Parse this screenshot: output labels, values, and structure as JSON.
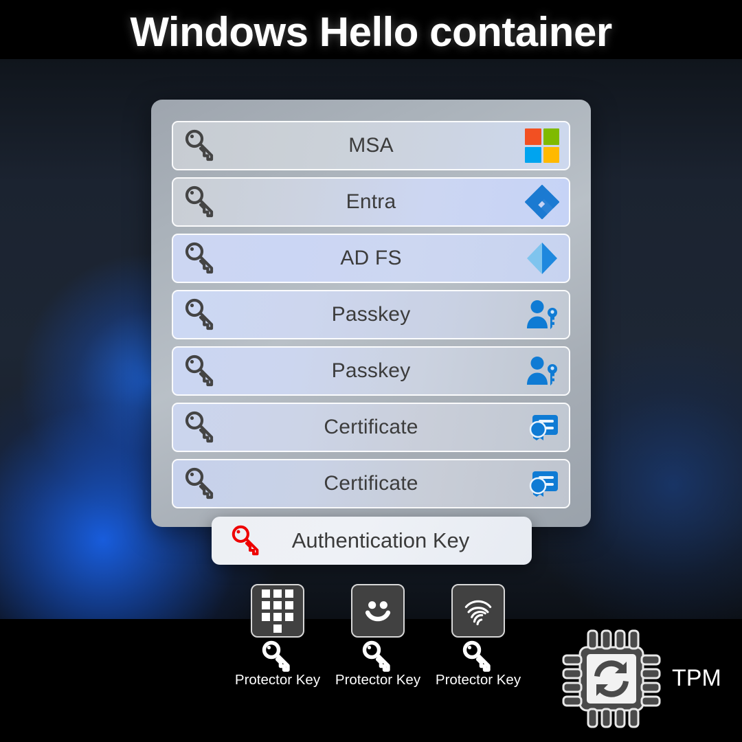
{
  "page": {
    "title": "Windows Hello container",
    "background_color": "#1d2634",
    "bar_color": "#000000"
  },
  "container": {
    "name": "Windows Hello container panel",
    "rows": [
      {
        "label": "MSA",
        "key_icon": "key-icon",
        "right_icon": "microsoft-logo-icon"
      },
      {
        "label": "Entra",
        "key_icon": "key-icon",
        "right_icon": "entra-logo-icon"
      },
      {
        "label": "AD FS",
        "key_icon": "key-icon",
        "right_icon": "adfs-logo-icon"
      },
      {
        "label": "Passkey",
        "key_icon": "key-icon",
        "right_icon": "passkey-user-icon"
      },
      {
        "label": "Passkey",
        "key_icon": "key-icon",
        "right_icon": "passkey-user-icon"
      },
      {
        "label": "Certificate",
        "key_icon": "key-icon",
        "right_icon": "certificate-icon"
      },
      {
        "label": "Certificate",
        "key_icon": "key-icon",
        "right_icon": "certificate-icon"
      }
    ]
  },
  "auth_key_card": {
    "label": "Authentication Key",
    "key_icon": "key-icon",
    "key_color": "#ee0000"
  },
  "protectors": [
    {
      "icon": "pin-keypad-icon",
      "label": "Protector Key",
      "key_icon": "key-icon"
    },
    {
      "icon": "face-smile-icon",
      "label": "Protector Key",
      "key_icon": "key-icon"
    },
    {
      "icon": "fingerprint-icon",
      "label": "Protector Key",
      "key_icon": "key-icon"
    }
  ],
  "tpm": {
    "label": "TPM",
    "icon": "tpm-chip-refresh-icon"
  },
  "colors": {
    "ms_orange": "#F25022",
    "ms_green": "#7FBA00",
    "ms_blue": "#00A4EF",
    "ms_yellow": "#FFB900",
    "entra_blue": "#1B7AD1",
    "adfs_light": "#7FC4EE",
    "adfs_dark": "#1E88DE",
    "passkey_blue": "#0F7BD4",
    "certificate_blue": "#0F7BD4",
    "key_outline_gray": "#444444",
    "auth_key_red": "#ee0000",
    "protector_tile": "#414141"
  }
}
